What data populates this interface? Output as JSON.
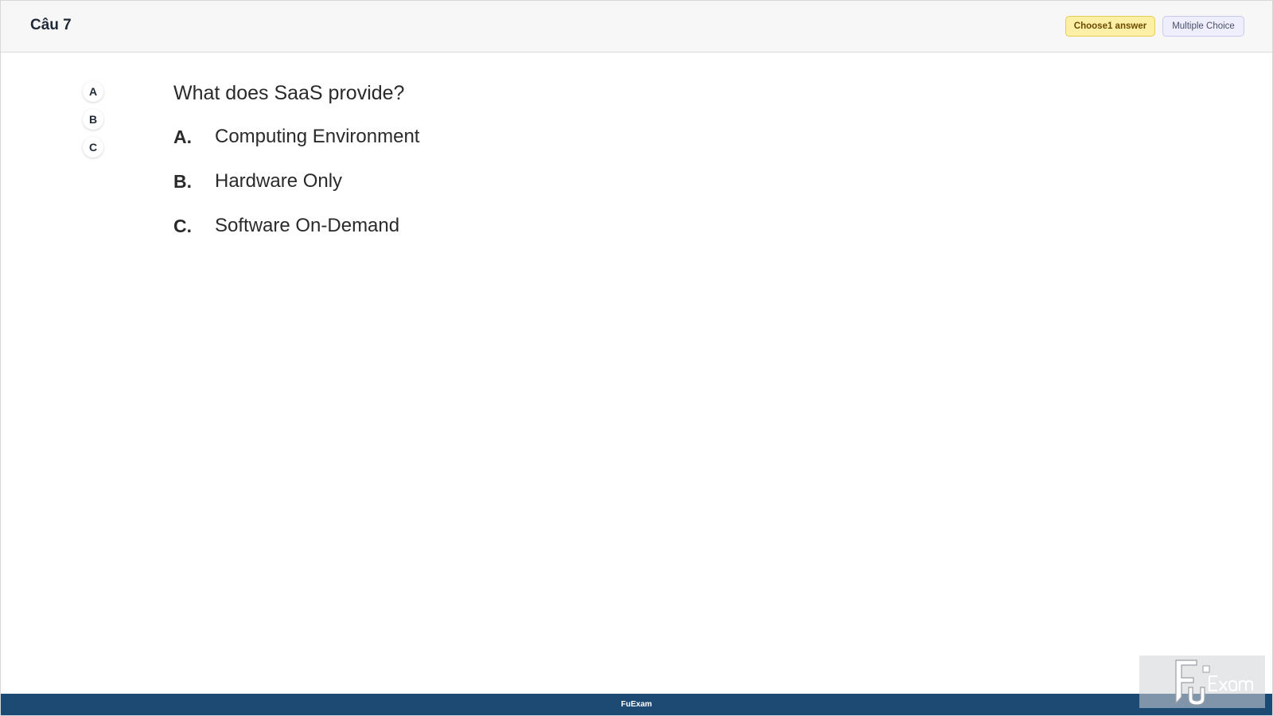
{
  "header": {
    "question_number": "Câu 7",
    "choose_badge": "Choose1 answer",
    "type_badge": "Multiple Choice"
  },
  "nav": {
    "items": [
      {
        "label": "A"
      },
      {
        "label": "B"
      },
      {
        "label": "C"
      }
    ]
  },
  "question": {
    "text": "What does SaaS provide?",
    "options": [
      {
        "letter": "A.",
        "text": "Computing Environment"
      },
      {
        "letter": "B.",
        "text": "Hardware Only"
      },
      {
        "letter": "C.",
        "text": "Software On-Demand"
      }
    ]
  },
  "footer": {
    "text": "FuExam"
  },
  "watermark": {
    "logo_text": "FUExam"
  },
  "colors": {
    "footer_bg": "#1d4a73",
    "choose_badge_bg": "#fdf0a6",
    "type_badge_bg": "#eeeefc"
  }
}
